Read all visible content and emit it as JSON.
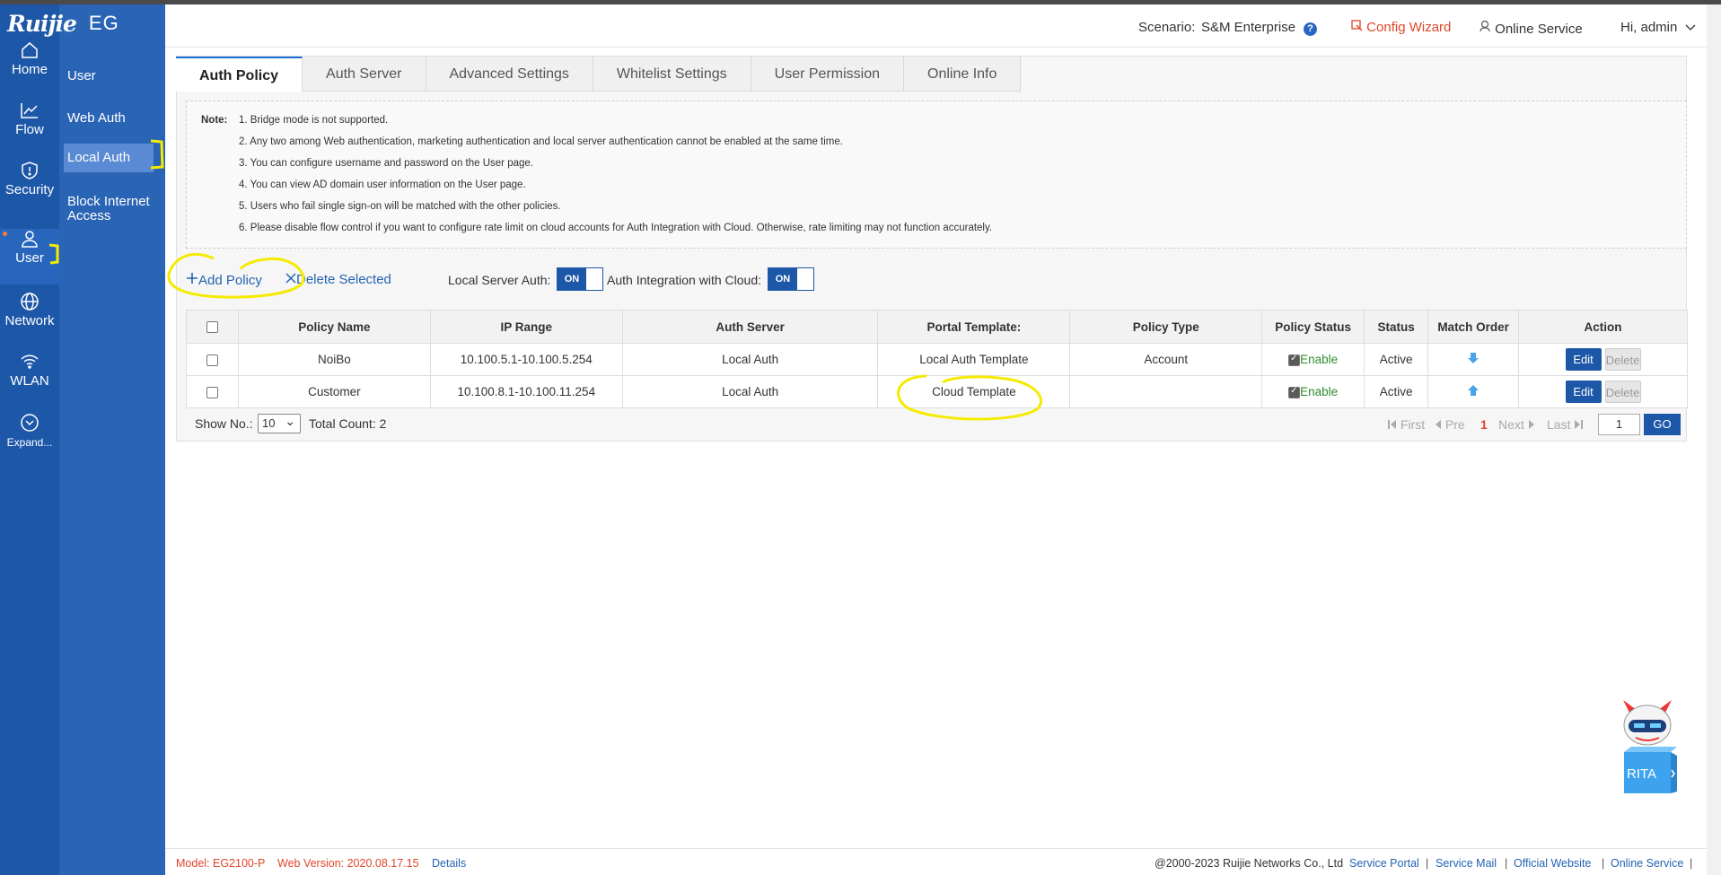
{
  "app": {
    "brand": "Ruijie",
    "product": "EG"
  },
  "rail": [
    {
      "label": "Home",
      "icon": "home-icon"
    },
    {
      "label": "Flow",
      "icon": "flow-chart-icon"
    },
    {
      "label": "Security",
      "icon": "shield-icon"
    },
    {
      "label": "User",
      "icon": "user-icon",
      "active": true
    },
    {
      "label": "Network",
      "icon": "globe-icon"
    },
    {
      "label": "WLAN",
      "icon": "wifi-icon"
    },
    {
      "label": "Expand...",
      "icon": "chevron-down-circle-icon"
    }
  ],
  "subnav": [
    {
      "label": "User"
    },
    {
      "label": "Web Auth"
    },
    {
      "label": "Local Auth",
      "active": true
    },
    {
      "label": "Block Internet Access"
    }
  ],
  "header": {
    "scenario_label": "Scenario:",
    "scenario_value": "S&M Enterprise",
    "help": "?",
    "config_wizard": "Config Wizard",
    "online_service": "Online Service",
    "greeting": "Hi, admin"
  },
  "tabs": [
    "Auth Policy",
    "Auth Server",
    "Advanced Settings",
    "Whitelist Settings",
    "User Permission",
    "Online Info"
  ],
  "note": {
    "label": "Note:",
    "lines": [
      "1. Bridge mode is not supported.",
      "2. Any two among Web authentication, marketing authentication and local server authentication cannot be enabled at the same time.",
      "3. You can configure username and password on the User page.",
      "4. You can view AD domain user information on the User page.",
      "5. Users who fail single sign-on will be matched with the other policies.",
      "6. Please disable flow control if you want to configure rate limit on cloud accounts for Auth Integration with Cloud. Otherwise, rate limiting may not function accurately."
    ]
  },
  "toolbar": {
    "add_policy": "Add Policy",
    "delete_selected": "Delete Selected",
    "local_server_auth_label": "Local Server Auth:",
    "local_server_auth_state": "ON",
    "cloud_integration_label": "Auth Integration with Cloud:",
    "cloud_integration_state": "ON"
  },
  "table": {
    "columns": [
      "Policy Name",
      "IP Range",
      "Auth Server",
      "Portal Template:",
      "Policy Type",
      "Policy Status",
      "Status",
      "Match Order",
      "Action"
    ],
    "rows": [
      {
        "name": "NoiBo",
        "ip_range": "10.100.5.1-10.100.5.254",
        "auth_server": "Local Auth",
        "portal_template": "Local Auth Template",
        "policy_type": "Account",
        "policy_status": "Enable",
        "status": "Active",
        "match_order": "down"
      },
      {
        "name": "Customer",
        "ip_range": "10.100.8.1-10.100.11.254",
        "auth_server": "Local Auth",
        "portal_template": "Cloud Template",
        "policy_type": "",
        "policy_status": "Enable",
        "status": "Active",
        "match_order": "up"
      }
    ],
    "edit_label": "Edit",
    "delete_label": "Delete"
  },
  "pager": {
    "show_no_label": "Show No.:",
    "page_size": "10",
    "total_count": "Total Count: 2",
    "first": "First",
    "prev": "Pre",
    "current": "1",
    "next": "Next",
    "last": "Last",
    "page_input": "1",
    "go": "GO"
  },
  "footer": {
    "model": "Model:  EG2100-P",
    "web_version": "Web Version:  2020.08.17.15",
    "details": "Details",
    "copyright": "@2000-2023 Ruijie Networks Co., Ltd",
    "links": [
      "Service Portal",
      "Service Mail",
      "Official Website",
      "Online Service"
    ]
  },
  "assistant": {
    "label": "RITA"
  },
  "colors": {
    "rail": "#1d57a8",
    "subnav": "#2a64b5",
    "accent": "#1d57a8",
    "wizard": "#e0452a",
    "enable_green": "#2e8b2e",
    "annotation_yellow": "#f5ea00"
  }
}
